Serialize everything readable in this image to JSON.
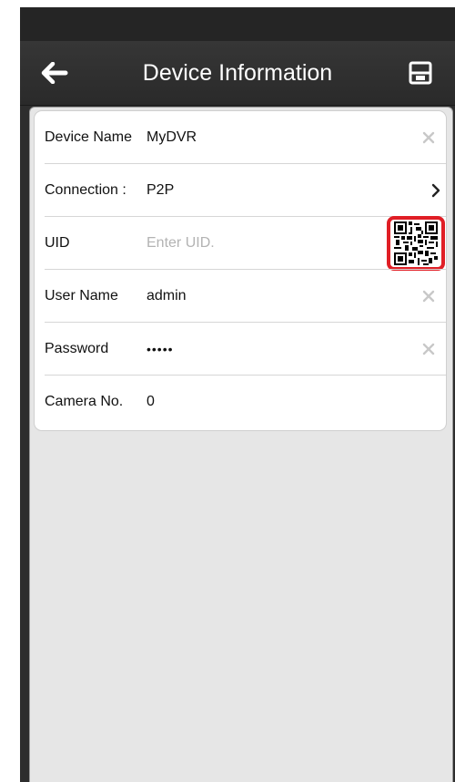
{
  "header": {
    "title": "Device Information",
    "back_icon": "arrow-left-icon",
    "save_icon": "floppy-disk-icon"
  },
  "form": {
    "device_name": {
      "label": "Device Name",
      "value": "MyDVR"
    },
    "connection": {
      "label": "Connection :",
      "value": "P2P"
    },
    "uid": {
      "label": "UID",
      "placeholder": "Enter UID.",
      "scan_icon": "qr-code-icon"
    },
    "user_name": {
      "label": "User Name",
      "value": "admin"
    },
    "password": {
      "label": "Password",
      "value": "•••••"
    },
    "camera_no": {
      "label": "Camera No.",
      "value": "0"
    }
  },
  "colors": {
    "navbar": "#2d2d2d",
    "background": "#e6e6e6",
    "qr_border": "#e01e25"
  }
}
